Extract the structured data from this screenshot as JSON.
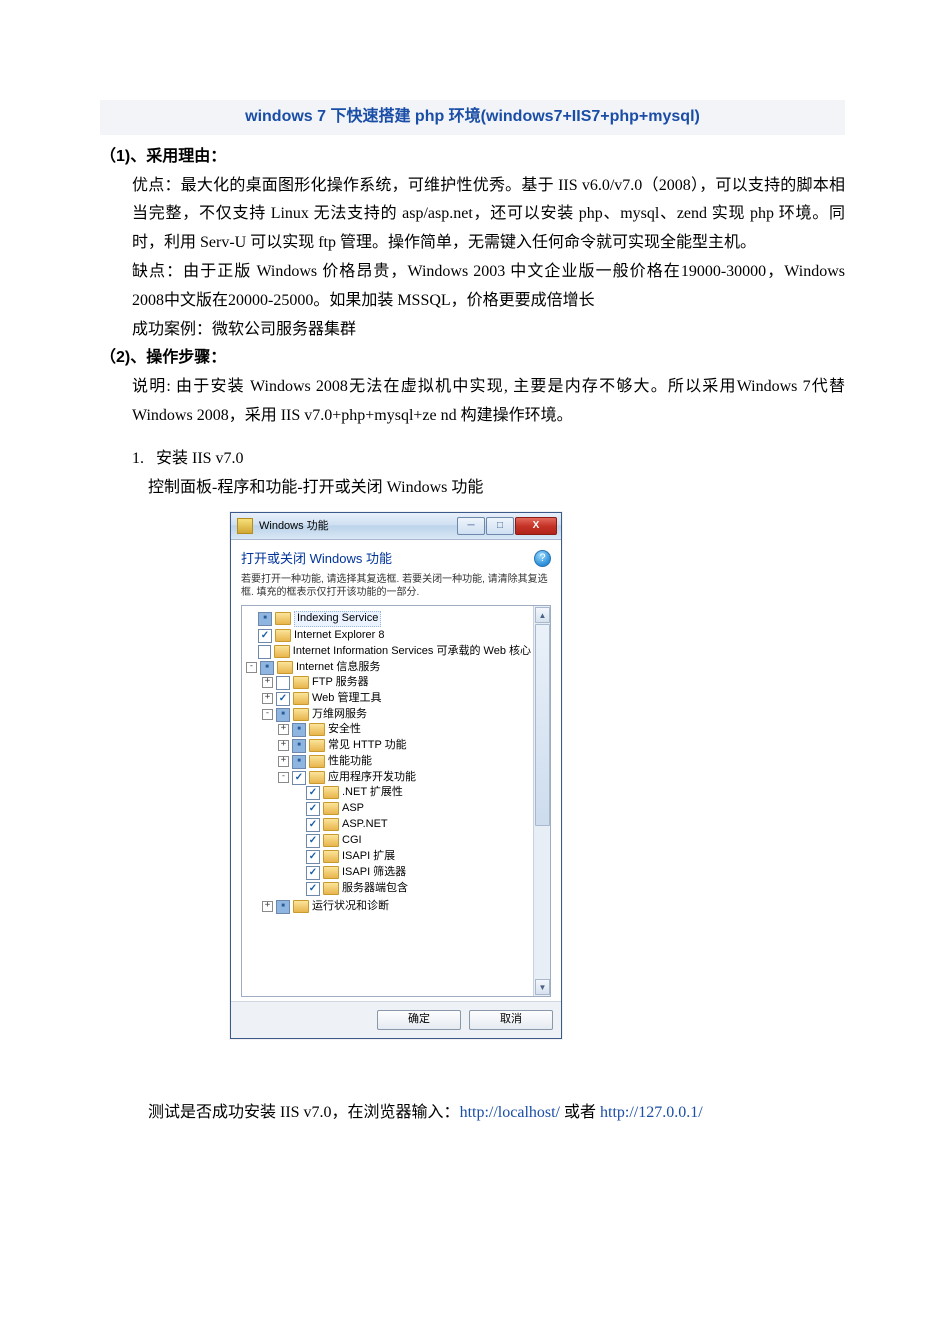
{
  "title": "windows 7 下快速搭建 php 环境(windows7+IIS7+php+mysql)",
  "h1": "（1)、采用理由：",
  "p1a": "优点：最大化的桌面图形化操作系统，可维护性优秀。基于 IIS v6.0/v7.0（2008），可以支持的脚本相当完整，不仅支持 Linux 无法支持的 asp/asp.net，还可以安装 php、mysql、zend 实现 php 环境。同时，利用 Serv-U 可以实现 ftp 管理。操作简单，无需键入任何命令就可实现全能型主机。",
  "p1b": "缺点：由于正版 Windows 价格昂贵，Windows 2003 中文企业版一般价格在19000-30000，Windows 2008中文版在20000-25000。如果加装 MSSQL，价格更要成倍增长",
  "p1c": "成功案例：微软公司服务器集群",
  "h2": "（2)、操作步骤：",
  "p2a": "说明: 由于安装 Windows 2008无法在虚拟机中实现, 主要是内存不够大。所以采用Windows 7代替 Windows 2008，采用 IIS v7.0+php+mysql+ze nd 构建操作环境。",
  "step1_no": "1.",
  "step1_title": "安装 IIS v7.0",
  "step1_sub": "控制面板-程序和功能-打开或关闭 Windows 功能",
  "dialog": {
    "window_title": "Windows 功能",
    "heading": "打开或关闭 Windows 功能",
    "description": "若要打开一种功能, 请选择其复选框. 若要关闭一种功能, 请清除其复选框. 填充的框表示仅打开该功能的一部分.",
    "btn_ok": "确定",
    "btn_cancel": "取消",
    "help": "?"
  },
  "tree": {
    "n0": "Indexing Service",
    "n1": "Internet Explorer 8",
    "n2": "Internet Information Services 可承载的 Web 核心",
    "n3": "Internet 信息服务",
    "n3_0": "FTP 服务器",
    "n3_1": "Web 管理工具",
    "n3_2": "万维网服务",
    "n3_2_0": "安全性",
    "n3_2_1": "常见 HTTP 功能",
    "n3_2_2": "性能功能",
    "n3_2_3": "应用程序开发功能",
    "n3_2_3_0": ".NET 扩展性",
    "n3_2_3_1": "ASP",
    "n3_2_3_2": "ASP.NET",
    "n3_2_3_3": "CGI",
    "n3_2_3_4": "ISAPI 扩展",
    "n3_2_3_5": "ISAPI 筛选器",
    "n3_2_3_6": "服务器端包含",
    "n3_3": "运行状况和诊断"
  },
  "test_prefix": "测试是否成功安装 IIS v7.0，在浏览器输入：",
  "test_link1": "http://localhost/",
  "test_mid": " 或者 ",
  "test_link2": "http://127.0.0.1/"
}
